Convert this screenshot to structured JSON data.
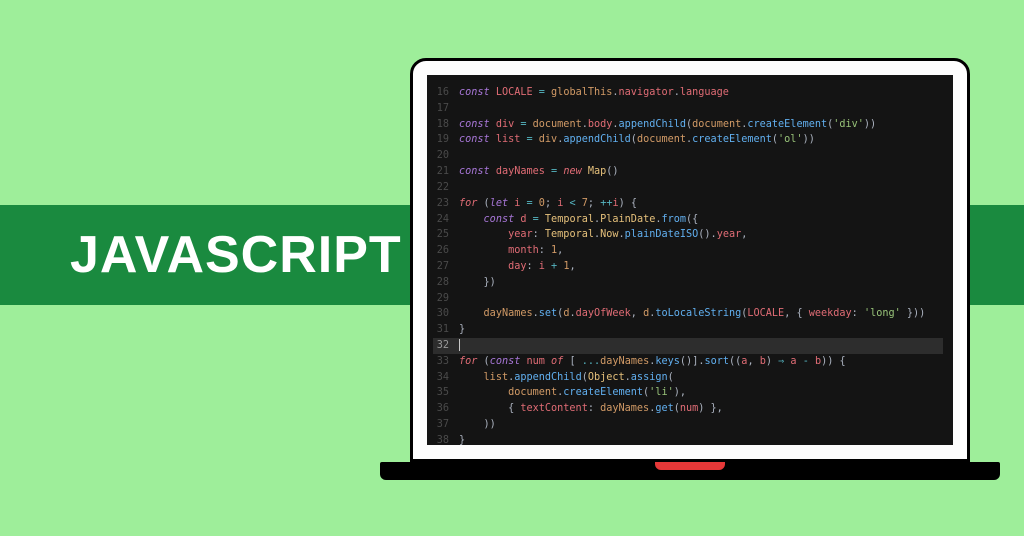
{
  "banner": {
    "title": "JAVASCRIPT"
  },
  "editor": {
    "line_numbers": [
      "16",
      "17",
      "18",
      "19",
      "20",
      "21",
      "22",
      "23",
      "24",
      "25",
      "26",
      "27",
      "28",
      "29",
      "30",
      "31",
      "32",
      "33",
      "34",
      "35",
      "36",
      "37",
      "38"
    ],
    "highlighted_line": 32,
    "code_lines": [
      {
        "n": "16",
        "html": "<span class='kw'>const</span> <span class='var'>LOCALE</span> <span class='op'>=</span> <span class='obj'>globalThis</span><span class='pn'>.</span><span class='prop'>navigator</span><span class='pn'>.</span><span class='prop'>language</span>"
      },
      {
        "n": "17",
        "html": ""
      },
      {
        "n": "18",
        "html": "<span class='kw'>const</span> <span class='var'>div</span> <span class='op'>=</span> <span class='obj'>document</span><span class='pn'>.</span><span class='prop'>body</span><span class='pn'>.</span><span class='fn'>appendChild</span><span class='pn'>(</span><span class='obj'>document</span><span class='pn'>.</span><span class='fn'>createElement</span><span class='pn'>(</span><span class='str'>'div'</span><span class='pn'>))</span>"
      },
      {
        "n": "19",
        "html": "<span class='kw'>const</span> <span class='var'>list</span> <span class='op'>=</span> <span class='obj'>div</span><span class='pn'>.</span><span class='fn'>appendChild</span><span class='pn'>(</span><span class='obj'>document</span><span class='pn'>.</span><span class='fn'>createElement</span><span class='pn'>(</span><span class='str'>'ol'</span><span class='pn'>))</span>"
      },
      {
        "n": "20",
        "html": ""
      },
      {
        "n": "21",
        "html": "<span class='kw'>const</span> <span class='var'>dayNames</span> <span class='op'>=</span> <span class='kw2'>new</span> <span class='cls'>Map</span><span class='pn'>()</span>"
      },
      {
        "n": "22",
        "html": ""
      },
      {
        "n": "23",
        "html": "<span class='kw2'>for</span> <span class='pn'>(</span><span class='kw'>let</span> <span class='var'>i</span> <span class='op'>=</span> <span class='num'>0</span><span class='pn'>;</span> <span class='var'>i</span> <span class='op'>&lt;</span> <span class='num'>7</span><span class='pn'>;</span> <span class='op'>++</span><span class='var'>i</span><span class='pn'>) {</span>"
      },
      {
        "n": "24",
        "html": "    <span class='kw'>const</span> <span class='var'>d</span> <span class='op'>=</span> <span class='cls'>Temporal</span><span class='pn'>.</span><span class='cls'>PlainDate</span><span class='pn'>.</span><span class='fn'>from</span><span class='pn'>({</span>"
      },
      {
        "n": "25",
        "html": "        <span class='prop'>year</span><span class='pn'>:</span> <span class='cls'>Temporal</span><span class='pn'>.</span><span class='cls'>Now</span><span class='pn'>.</span><span class='fn'>plainDateISO</span><span class='pn'>().</span><span class='prop'>year</span><span class='pn'>,</span>"
      },
      {
        "n": "26",
        "html": "        <span class='prop'>month</span><span class='pn'>:</span> <span class='num'>1</span><span class='pn'>,</span>"
      },
      {
        "n": "27",
        "html": "        <span class='prop'>day</span><span class='pn'>:</span> <span class='var'>i</span> <span class='op'>+</span> <span class='num'>1</span><span class='pn'>,</span>"
      },
      {
        "n": "28",
        "html": "    <span class='pn'>})</span>"
      },
      {
        "n": "29",
        "html": ""
      },
      {
        "n": "30",
        "html": "    <span class='obj'>dayNames</span><span class='pn'>.</span><span class='fn'>set</span><span class='pn'>(</span><span class='obj'>d</span><span class='pn'>.</span><span class='prop'>dayOfWeek</span><span class='pn'>,</span> <span class='obj'>d</span><span class='pn'>.</span><span class='fn'>toLocaleString</span><span class='pn'>(</span><span class='var'>LOCALE</span><span class='pn'>, {</span> <span class='prop'>weekday</span><span class='pn'>:</span> <span class='str'>'long'</span> <span class='pn'>}))</span>"
      },
      {
        "n": "31",
        "html": "<span class='pn'>}</span>"
      },
      {
        "n": "32",
        "html": "<span class='cursor'></span>"
      },
      {
        "n": "33",
        "html": "<span class='kw2'>for</span> <span class='pn'>(</span><span class='kw'>const</span> <span class='var'>num</span> <span class='kw2'>of</span> <span class='pn'>[</span> <span class='op'>...</span><span class='obj'>dayNames</span><span class='pn'>.</span><span class='fn'>keys</span><span class='pn'>()].</span><span class='fn'>sort</span><span class='pn'>((</span><span class='var'>a</span><span class='pn'>,</span> <span class='var'>b</span><span class='pn'>)</span> <span class='op'>⇒</span> <span class='var'>a</span> <span class='op'>-</span> <span class='var'>b</span><span class='pn'>)) {</span>"
      },
      {
        "n": "34",
        "html": "    <span class='obj'>list</span><span class='pn'>.</span><span class='fn'>appendChild</span><span class='pn'>(</span><span class='cls'>Object</span><span class='pn'>.</span><span class='fn'>assign</span><span class='pn'>(</span>"
      },
      {
        "n": "35",
        "html": "        <span class='obj'>document</span><span class='pn'>.</span><span class='fn'>createElement</span><span class='pn'>(</span><span class='str'>'li'</span><span class='pn'>),</span>"
      },
      {
        "n": "36",
        "html": "        <span class='pn'>{</span> <span class='prop'>textContent</span><span class='pn'>:</span> <span class='obj'>dayNames</span><span class='pn'>.</span><span class='fn'>get</span><span class='pn'>(</span><span class='var'>num</span><span class='pn'>) },</span>"
      },
      {
        "n": "37",
        "html": "    <span class='pn'>))</span>"
      },
      {
        "n": "38",
        "html": "<span class='pn'>}</span>"
      }
    ]
  }
}
